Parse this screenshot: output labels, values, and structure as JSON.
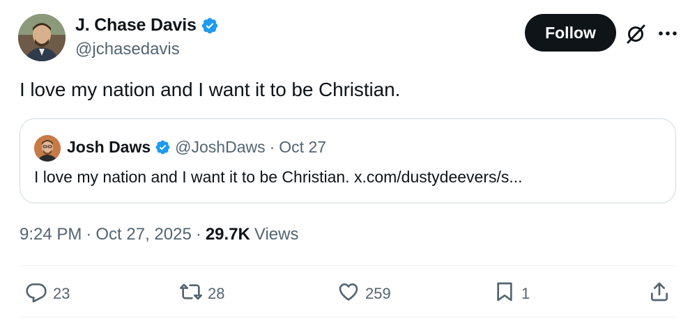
{
  "author": {
    "display_name": "J. Chase Davis",
    "handle": "@jchasedavis",
    "verified": true
  },
  "header": {
    "follow_label": "Follow",
    "icons": [
      "grok-icon",
      "more-icon"
    ]
  },
  "tweet": {
    "text": "I love my nation and I want it to be Christian."
  },
  "quoted_tweet": {
    "display_name": "Josh Daws",
    "handle": "@JoshDaws",
    "separator": "·",
    "date": "Oct 27",
    "text": "I love my nation and I want it to be Christian. x.com/dustydeevers/s..."
  },
  "meta": {
    "time": "9:24 PM",
    "separator": "·",
    "date": "Oct 27, 2025",
    "separator2": "·",
    "views_count": "29.7K",
    "views_label": "Views"
  },
  "actions": {
    "replies": "23",
    "reposts": "28",
    "likes": "259",
    "bookmarks": "1"
  },
  "colors": {
    "text_primary": "#0f1419",
    "text_secondary": "#536471",
    "verified_blue": "#1d9bf0",
    "border": "#cfd9de",
    "button_bg": "#0f1419"
  }
}
